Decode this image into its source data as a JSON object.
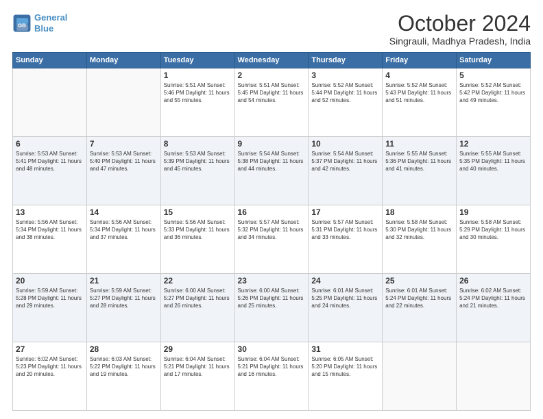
{
  "logo": {
    "line1": "General",
    "line2": "Blue"
  },
  "title": "October 2024",
  "location": "Singrauli, Madhya Pradesh, India",
  "days_of_week": [
    "Sunday",
    "Monday",
    "Tuesday",
    "Wednesday",
    "Thursday",
    "Friday",
    "Saturday"
  ],
  "weeks": [
    [
      {
        "day": "",
        "info": ""
      },
      {
        "day": "",
        "info": ""
      },
      {
        "day": "1",
        "info": "Sunrise: 5:51 AM\nSunset: 5:46 PM\nDaylight: 11 hours and 55 minutes."
      },
      {
        "day": "2",
        "info": "Sunrise: 5:51 AM\nSunset: 5:45 PM\nDaylight: 11 hours and 54 minutes."
      },
      {
        "day": "3",
        "info": "Sunrise: 5:52 AM\nSunset: 5:44 PM\nDaylight: 11 hours and 52 minutes."
      },
      {
        "day": "4",
        "info": "Sunrise: 5:52 AM\nSunset: 5:43 PM\nDaylight: 11 hours and 51 minutes."
      },
      {
        "day": "5",
        "info": "Sunrise: 5:52 AM\nSunset: 5:42 PM\nDaylight: 11 hours and 49 minutes."
      }
    ],
    [
      {
        "day": "6",
        "info": "Sunrise: 5:53 AM\nSunset: 5:41 PM\nDaylight: 11 hours and 48 minutes."
      },
      {
        "day": "7",
        "info": "Sunrise: 5:53 AM\nSunset: 5:40 PM\nDaylight: 11 hours and 47 minutes."
      },
      {
        "day": "8",
        "info": "Sunrise: 5:53 AM\nSunset: 5:39 PM\nDaylight: 11 hours and 45 minutes."
      },
      {
        "day": "9",
        "info": "Sunrise: 5:54 AM\nSunset: 5:38 PM\nDaylight: 11 hours and 44 minutes."
      },
      {
        "day": "10",
        "info": "Sunrise: 5:54 AM\nSunset: 5:37 PM\nDaylight: 11 hours and 42 minutes."
      },
      {
        "day": "11",
        "info": "Sunrise: 5:55 AM\nSunset: 5:36 PM\nDaylight: 11 hours and 41 minutes."
      },
      {
        "day": "12",
        "info": "Sunrise: 5:55 AM\nSunset: 5:35 PM\nDaylight: 11 hours and 40 minutes."
      }
    ],
    [
      {
        "day": "13",
        "info": "Sunrise: 5:56 AM\nSunset: 5:34 PM\nDaylight: 11 hours and 38 minutes."
      },
      {
        "day": "14",
        "info": "Sunrise: 5:56 AM\nSunset: 5:34 PM\nDaylight: 11 hours and 37 minutes."
      },
      {
        "day": "15",
        "info": "Sunrise: 5:56 AM\nSunset: 5:33 PM\nDaylight: 11 hours and 36 minutes."
      },
      {
        "day": "16",
        "info": "Sunrise: 5:57 AM\nSunset: 5:32 PM\nDaylight: 11 hours and 34 minutes."
      },
      {
        "day": "17",
        "info": "Sunrise: 5:57 AM\nSunset: 5:31 PM\nDaylight: 11 hours and 33 minutes."
      },
      {
        "day": "18",
        "info": "Sunrise: 5:58 AM\nSunset: 5:30 PM\nDaylight: 11 hours and 32 minutes."
      },
      {
        "day": "19",
        "info": "Sunrise: 5:58 AM\nSunset: 5:29 PM\nDaylight: 11 hours and 30 minutes."
      }
    ],
    [
      {
        "day": "20",
        "info": "Sunrise: 5:59 AM\nSunset: 5:28 PM\nDaylight: 11 hours and 29 minutes."
      },
      {
        "day": "21",
        "info": "Sunrise: 5:59 AM\nSunset: 5:27 PM\nDaylight: 11 hours and 28 minutes."
      },
      {
        "day": "22",
        "info": "Sunrise: 6:00 AM\nSunset: 5:27 PM\nDaylight: 11 hours and 26 minutes."
      },
      {
        "day": "23",
        "info": "Sunrise: 6:00 AM\nSunset: 5:26 PM\nDaylight: 11 hours and 25 minutes."
      },
      {
        "day": "24",
        "info": "Sunrise: 6:01 AM\nSunset: 5:25 PM\nDaylight: 11 hours and 24 minutes."
      },
      {
        "day": "25",
        "info": "Sunrise: 6:01 AM\nSunset: 5:24 PM\nDaylight: 11 hours and 22 minutes."
      },
      {
        "day": "26",
        "info": "Sunrise: 6:02 AM\nSunset: 5:24 PM\nDaylight: 11 hours and 21 minutes."
      }
    ],
    [
      {
        "day": "27",
        "info": "Sunrise: 6:02 AM\nSunset: 5:23 PM\nDaylight: 11 hours and 20 minutes."
      },
      {
        "day": "28",
        "info": "Sunrise: 6:03 AM\nSunset: 5:22 PM\nDaylight: 11 hours and 19 minutes."
      },
      {
        "day": "29",
        "info": "Sunrise: 6:04 AM\nSunset: 5:21 PM\nDaylight: 11 hours and 17 minutes."
      },
      {
        "day": "30",
        "info": "Sunrise: 6:04 AM\nSunset: 5:21 PM\nDaylight: 11 hours and 16 minutes."
      },
      {
        "day": "31",
        "info": "Sunrise: 6:05 AM\nSunset: 5:20 PM\nDaylight: 11 hours and 15 minutes."
      },
      {
        "day": "",
        "info": ""
      },
      {
        "day": "",
        "info": ""
      }
    ]
  ]
}
